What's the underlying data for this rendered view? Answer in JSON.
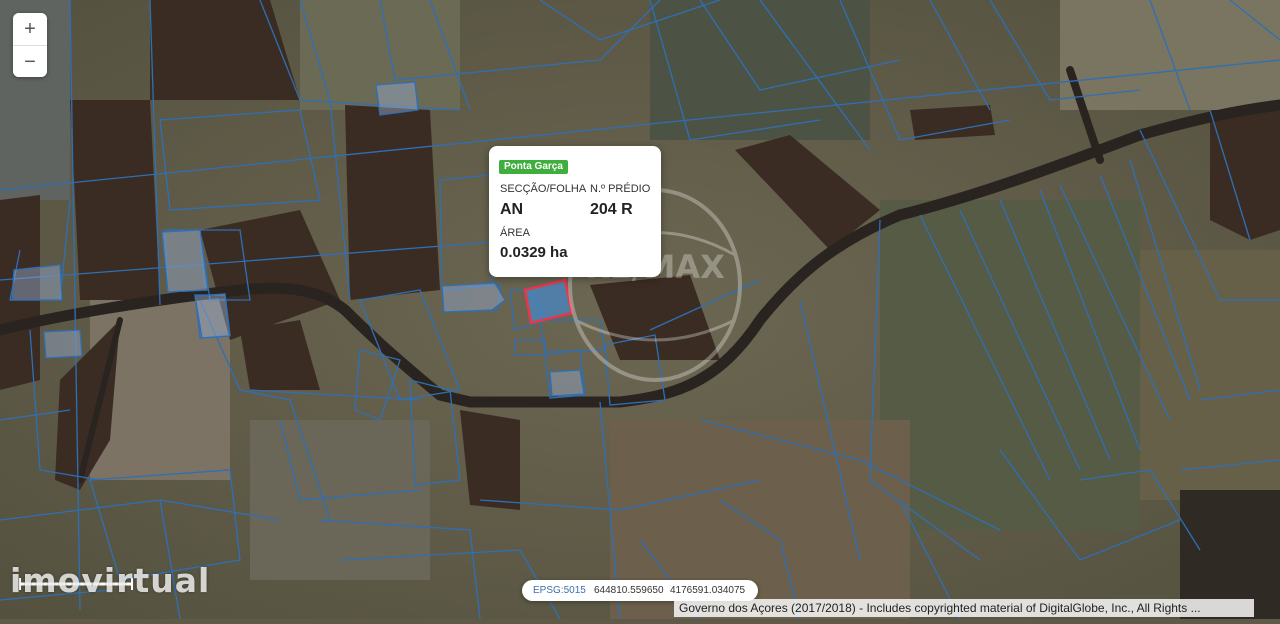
{
  "map": {
    "zoom_in_label": "+",
    "zoom_out_label": "−",
    "colors": {
      "parcel_line": "#2f6fb5",
      "selected_parcel": "#e8364a",
      "road": "#2a2420",
      "badge": "#3fae3d"
    }
  },
  "popup": {
    "locality": "Ponta Garça",
    "section_label": "SECÇÃO/FOLHA",
    "section_value": "AN",
    "property_label": "N.º PRÉDIO",
    "property_value": "204 R",
    "area_label": "ÁREA",
    "area_value": "0.0329 ha"
  },
  "coordinates": {
    "epsg": "EPSG:5015",
    "x": "644810.559650",
    "y": "4176591.034075"
  },
  "attribution": "Governo dos Açores (2017/2018) - Includes copyrighted material of DigitalGlobe, Inc., All Rights ...",
  "watermark": "imovirtual",
  "logo_text": "RE/MAX"
}
